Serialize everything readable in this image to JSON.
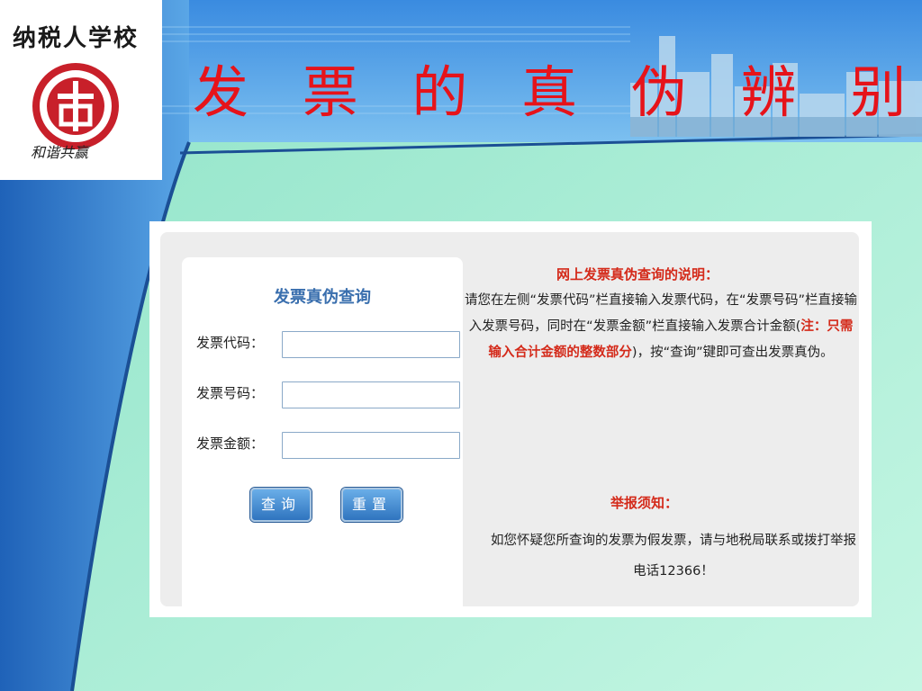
{
  "header": {
    "brand": "纳税人学校",
    "motto": "和谐共赢",
    "title": "发 票 的 真 伪 辨 别"
  },
  "form": {
    "title": "发票真伪查询",
    "fields": [
      {
        "label": "发票代码：",
        "value": ""
      },
      {
        "label": "发票号码：",
        "value": ""
      },
      {
        "label": "发票金额：",
        "value": ""
      }
    ],
    "query_button": "查询",
    "reset_button": "重置"
  },
  "info": {
    "title": "网上发票真伪查询的说明：",
    "text_before_note": "请您在左侧“发票代码”栏直接输入发票代码，在“发票号码”栏直接输入发票号码，同时在“发票金额”栏直接输入发票合计金额(",
    "note": "注：只需输入合计金额的整数部分",
    "text_after_note": ")，按“查询”键即可查出发票真伪。"
  },
  "report": {
    "title": "举报须知：",
    "text": "如您怀疑您所查询的发票为假发票，请与地税局联系或拨打举报电话12366！"
  },
  "colors": {
    "title_red": "#e6131a",
    "header_blue": "#2d78c4",
    "background_green": "#9fe9cf",
    "button_blue": "#2f74bf",
    "note_red": "#d42a1a"
  }
}
